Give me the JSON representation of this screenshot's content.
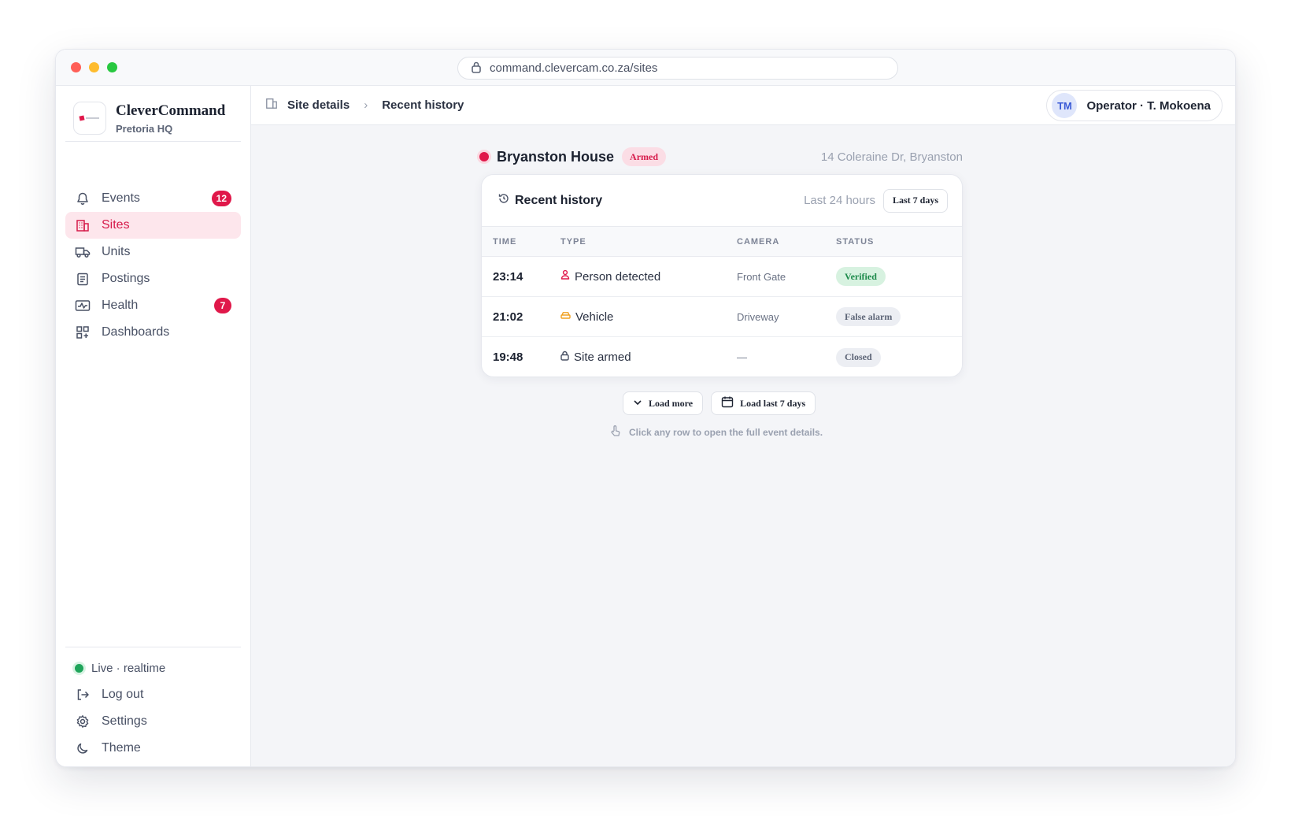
{
  "browser": {
    "url": "command.clevercam.co.za/sites"
  },
  "brand": {
    "name": "CleverCommand",
    "subtitle": "Pretoria HQ"
  },
  "sidebar": {
    "items": [
      {
        "label": "Events",
        "icon": "bell-icon",
        "badge": "12"
      },
      {
        "label": "Sites",
        "icon": "building-icon",
        "active": true
      },
      {
        "label": "Units",
        "icon": "truck-icon"
      },
      {
        "label": "Postings",
        "icon": "clipboard-icon"
      },
      {
        "label": "Health",
        "icon": "pulse-icon",
        "badge": "7"
      },
      {
        "label": "Dashboards",
        "icon": "grid-plus-icon"
      }
    ],
    "bottom": {
      "live": "Live · realtime",
      "logout": "Log out",
      "settings": "Settings",
      "theme": "Theme"
    }
  },
  "topbar": {
    "breadcrumb": [
      "Site details",
      "Recent history"
    ],
    "user": {
      "initials": "TM",
      "label": "Operator · T. Mokoena"
    }
  },
  "site": {
    "name": "Bryanston House",
    "status": "Armed",
    "address": "14 Coleraine Dr, Bryanston"
  },
  "history": {
    "title": "Recent history",
    "range_label": "Last 24 hours",
    "range_button": "Last 7 days",
    "columns": [
      "TIME",
      "TYPE",
      "CAMERA",
      "STATUS"
    ],
    "rows": [
      {
        "time": "23:14",
        "type": "Person detected",
        "type_icon": "person-icon",
        "camera": "Front Gate",
        "status": "Verified"
      },
      {
        "time": "21:02",
        "type": "Vehicle",
        "type_icon": "car-icon",
        "camera": "Driveway",
        "status": "False alarm"
      },
      {
        "time": "19:48",
        "type": "Site armed",
        "type_icon": "lock-icon",
        "camera": "—",
        "status": "Closed"
      }
    ]
  },
  "actions": {
    "load_more": "Load more",
    "load_last": "Load last 7 days"
  },
  "hint": "Click any row to open the full event details.",
  "colors": {
    "accent": "#e0184a",
    "live": "#1fa45a",
    "verified": "#1c8a4a"
  }
}
